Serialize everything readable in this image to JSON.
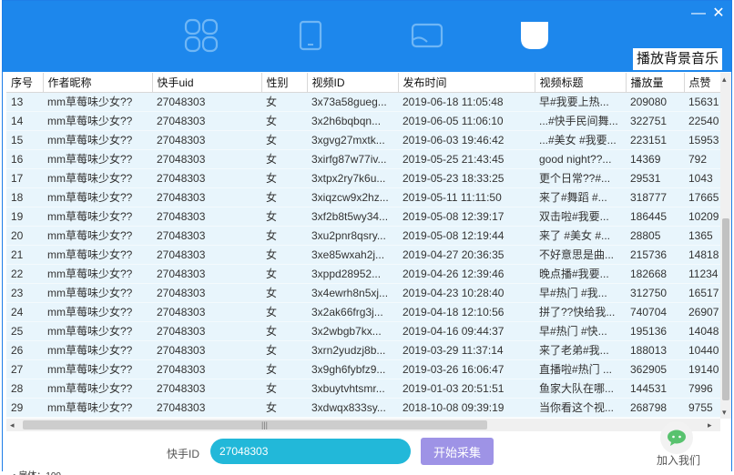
{
  "header": {
    "nav_icons": [
      "grid-icon",
      "phone-icon",
      "screen-icon",
      "leaf-icon"
    ],
    "bgm_label": "播放背景音乐",
    "minimize_glyph": "—",
    "close_glyph": "✕"
  },
  "table": {
    "columns": [
      "序号",
      "作者昵称",
      "快手uid",
      "性别",
      "视频ID",
      "发布时间",
      "视频标题",
      "播放量",
      "点赞"
    ],
    "rows": [
      [
        "13",
        "mm草莓味少女??",
        "27048303",
        "女",
        "3x73a58gueg...",
        "2019-06-18 11:05:48",
        "早#我要上热...",
        "209080",
        "15631"
      ],
      [
        "14",
        "mm草莓味少女??",
        "27048303",
        "女",
        "3x2h6bqbqn...",
        "2019-06-05 11:06:10",
        "...#快手民间舞...",
        "322751",
        "22540"
      ],
      [
        "15",
        "mm草莓味少女??",
        "27048303",
        "女",
        "3xgvg27mxtk...",
        "2019-06-03 19:46:42",
        "...#美女 #我要...",
        "223151",
        "15953"
      ],
      [
        "16",
        "mm草莓味少女??",
        "27048303",
        "女",
        "3xirfg87w77iv...",
        "2019-05-25 21:43:45",
        "good night??...",
        "14369",
        "792"
      ],
      [
        "17",
        "mm草莓味少女??",
        "27048303",
        "女",
        "3xtpx2ry7k6u...",
        "2019-05-23 18:33:25",
        "更个日常??#...",
        "29531",
        "1043"
      ],
      [
        "18",
        "mm草莓味少女??",
        "27048303",
        "女",
        "3xiqzcw9x2hz...",
        "2019-05-11 11:11:50",
        "来了#舞蹈 #...",
        "318777",
        "17665"
      ],
      [
        "19",
        "mm草莓味少女??",
        "27048303",
        "女",
        "3xf2b8t5wy34...",
        "2019-05-08 12:39:17",
        "双击啦#我要...",
        "186445",
        "10209"
      ],
      [
        "20",
        "mm草莓味少女??",
        "27048303",
        "女",
        "3xu2pnr8qsry...",
        "2019-05-08 12:19:44",
        "来了 #美女 #...",
        "28805",
        "1365"
      ],
      [
        "21",
        "mm草莓味少女??",
        "27048303",
        "女",
        "3xe85wxah2j...",
        "2019-04-27 20:36:35",
        "不好意思是曲...",
        "215736",
        "14818"
      ],
      [
        "22",
        "mm草莓味少女??",
        "27048303",
        "女",
        "3xppd28952...",
        "2019-04-26 12:39:46",
        "晚点播#我要...",
        "182668",
        "11234"
      ],
      [
        "23",
        "mm草莓味少女??",
        "27048303",
        "女",
        "3x4ewrh8n5xj...",
        "2019-04-23 10:28:40",
        "早#热门 #我...",
        "312750",
        "16517"
      ],
      [
        "24",
        "mm草莓味少女??",
        "27048303",
        "女",
        "3x2ak66frg3j...",
        "2019-04-18 12:10:56",
        "拼了??快给我...",
        "740704",
        "26907"
      ],
      [
        "25",
        "mm草莓味少女??",
        "27048303",
        "女",
        "3x2wbgb7kx...",
        "2019-04-16 09:44:37",
        "早#热门 #快...",
        "195136",
        "14048"
      ],
      [
        "26",
        "mm草莓味少女??",
        "27048303",
        "女",
        "3xrn2yudzj8b...",
        "2019-03-29 11:37:14",
        "来了老弟#我...",
        "188013",
        "10440"
      ],
      [
        "27",
        "mm草莓味少女??",
        "27048303",
        "女",
        "3x9gh6fybfz9...",
        "2019-03-26 16:06:47",
        "直播啦#热门 ...",
        "362905",
        "19140"
      ],
      [
        "28",
        "mm草莓味少女??",
        "27048303",
        "女",
        "3xbuytvhtsmr...",
        "2019-01-03 20:51:51",
        "鱼家大队在哪...",
        "144531",
        "7996"
      ],
      [
        "29",
        "mm草莓味少女??",
        "27048303",
        "女",
        "3xdwqx833sy...",
        "2018-10-08 09:39:19",
        "当你看这个视...",
        "268798",
        "9755"
      ]
    ]
  },
  "footer": {
    "uid_label": "快手ID",
    "uid_value": "27048303",
    "start_label": "开始采集",
    "join_label": "加入我们"
  },
  "below_text": "• 雇体：100"
}
